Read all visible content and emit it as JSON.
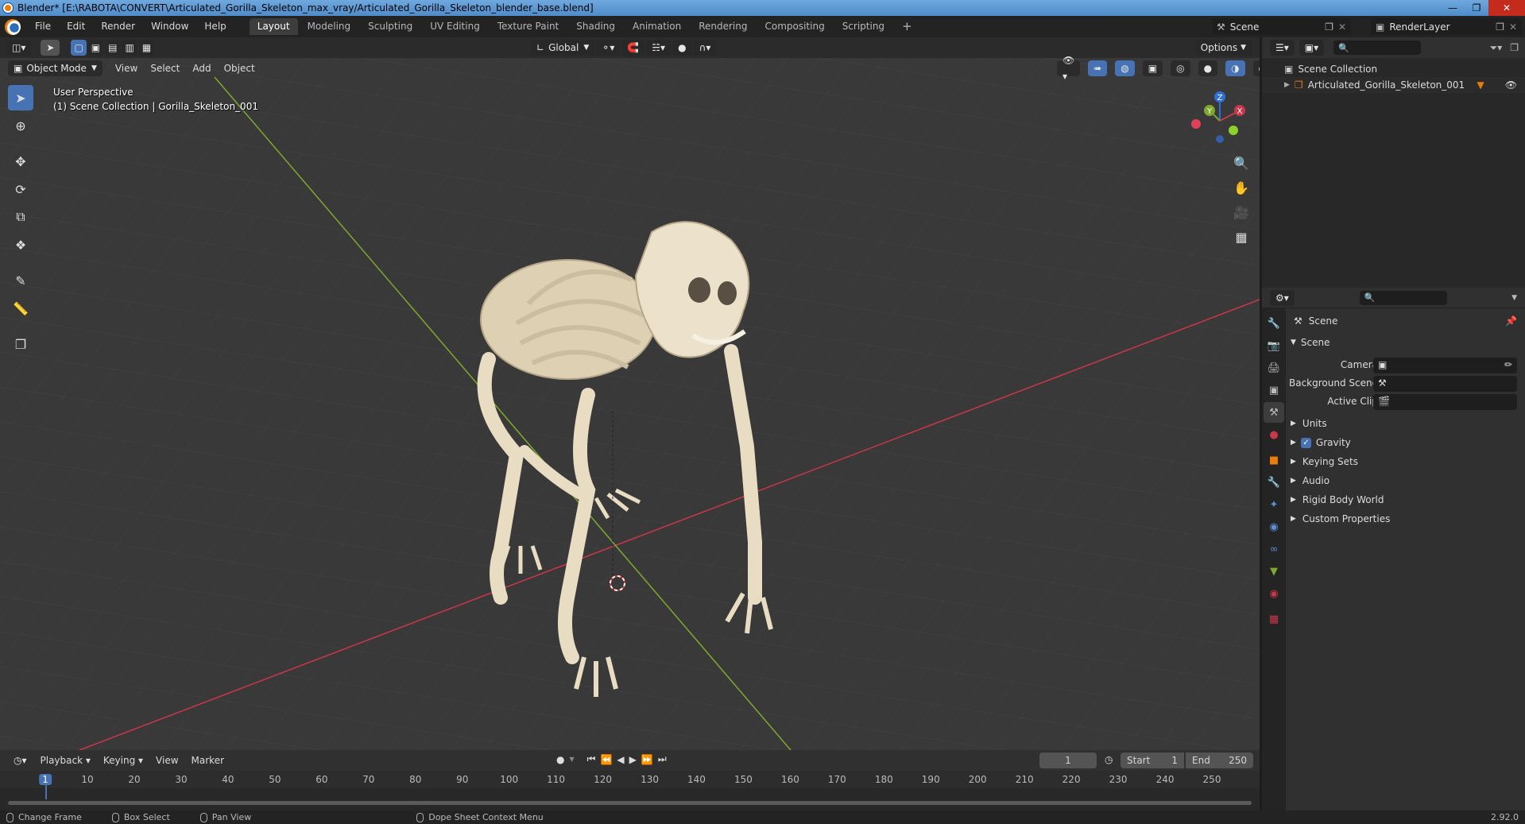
{
  "window": {
    "title": "Blender* [E:\\RABOTA\\CONVERT\\Articulated_Gorilla_Skeleton_max_vray/Articulated_Gorilla_Skeleton_blender_base.blend]",
    "controls": [
      "—",
      "❐",
      "✕"
    ]
  },
  "menu": [
    "File",
    "Edit",
    "Render",
    "Window",
    "Help"
  ],
  "workspaces": [
    {
      "label": "Layout",
      "active": true
    },
    {
      "label": "Modeling"
    },
    {
      "label": "Sculpting"
    },
    {
      "label": "UV Editing"
    },
    {
      "label": "Texture Paint"
    },
    {
      "label": "Shading"
    },
    {
      "label": "Animation"
    },
    {
      "label": "Rendering"
    },
    {
      "label": "Compositing"
    },
    {
      "label": "Scripting"
    }
  ],
  "add_workspace": "+",
  "scene_selector": {
    "value": "Scene"
  },
  "render_layer": {
    "value": "RenderLayer"
  },
  "viewport": {
    "transform_orientation": "Global",
    "options_label": "Options",
    "mode": "Object Mode",
    "header_menus": [
      "View",
      "Select",
      "Add",
      "Object"
    ],
    "overlay_line1": "User Perspective",
    "overlay_line2": "(1) Scene Collection | Gorilla_Skeleton_001",
    "gizmo": {
      "x": "X",
      "y": "Y",
      "z": "Z"
    }
  },
  "outliner": {
    "root": "Scene Collection",
    "items": [
      "Articulated_Gorilla_Skeleton_001"
    ]
  },
  "properties": {
    "context": "Scene",
    "panel_title": "Scene",
    "fields": [
      {
        "label": "Camera",
        "value": ""
      },
      {
        "label": "Background Scene",
        "value": ""
      },
      {
        "label": "Active Clip",
        "value": ""
      }
    ],
    "subpanels": [
      {
        "label": "Units",
        "checkbox": false
      },
      {
        "label": "Gravity",
        "checkbox": true
      },
      {
        "label": "Keying Sets",
        "checkbox": false
      },
      {
        "label": "Audio",
        "checkbox": false
      },
      {
        "label": "Rigid Body World",
        "checkbox": false
      },
      {
        "label": "Custom Properties",
        "checkbox": false
      }
    ]
  },
  "timeline": {
    "menus": [
      "Playback",
      "Keying",
      "View",
      "Marker"
    ],
    "current_frame": "1",
    "start_label": "Start",
    "start": "1",
    "end_label": "End",
    "end": "250",
    "ticks": [
      "1",
      "10",
      "20",
      "30",
      "40",
      "50",
      "60",
      "70",
      "80",
      "90",
      "100",
      "110",
      "120",
      "130",
      "140",
      "150",
      "160",
      "170",
      "180",
      "190",
      "200",
      "210",
      "220",
      "230",
      "240",
      "250"
    ]
  },
  "statusbar": {
    "items": [
      "Change Frame",
      "Box Select",
      "Pan View",
      "Dope Sheet Context Menu"
    ],
    "version": "2.92.0"
  },
  "colors": {
    "accent": "#4772b3",
    "x_axis": "#c9374a",
    "y_axis": "#7fa82f",
    "bone": "#e8dcc3"
  }
}
